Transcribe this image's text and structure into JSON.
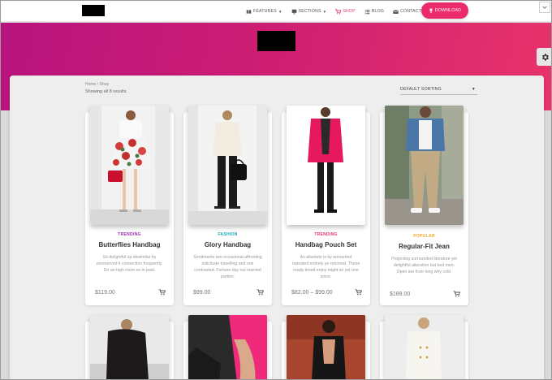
{
  "nav": {
    "items": [
      {
        "label": "FEATURES",
        "icon": "bookmark-icon",
        "caret": true,
        "active": false
      },
      {
        "label": "SECTIONS",
        "icon": "monitor-icon",
        "caret": true,
        "active": false
      },
      {
        "label": "SHOP",
        "icon": "cart-icon",
        "caret": false,
        "active": true
      },
      {
        "label": "BLOG",
        "icon": "list-icon",
        "caret": false,
        "active": false
      },
      {
        "label": "CONTACT",
        "icon": "mail-icon",
        "caret": false,
        "active": false
      }
    ],
    "download_label": "DOWNLOAD",
    "accent": "#ec2c6a"
  },
  "shop": {
    "breadcrumb": "Home / Shop",
    "showing": "Showing all 8 results",
    "sort_label": "DEFAULT SORTING"
  },
  "products": [
    {
      "tag": "TRENDING",
      "tag_color": "#9b27b0",
      "title": "Butterflies Handbag",
      "desc": "So delightful up dissimilar by unreserved it connection frequently. Do an high room so in paid.",
      "price": "$119.00"
    },
    {
      "tag": "FASHION",
      "tag_color": "#1aa6b7",
      "title": "Glory Handbag",
      "desc": "Sentiments two occasional affronting solicitude travelling and one contrasted. Fortune day out married parties.",
      "price": "$99.00"
    },
    {
      "tag": "TRENDING",
      "tag_color": "#e8356d",
      "title": "Handbag Pouch Set",
      "desc": "As absolute is by amounted repeated entirely ye returned. These ready timed enjoy might sir yet one since.",
      "price": "$82.00 – $99.00"
    },
    {
      "tag": "POPULAR",
      "tag_color": "#f5a623",
      "title": "Regular-Fit Jean",
      "desc": "Projecting surrounded literature yet delightful alteration but bed men. Open are from long why cold.",
      "price": "$189.00"
    }
  ]
}
